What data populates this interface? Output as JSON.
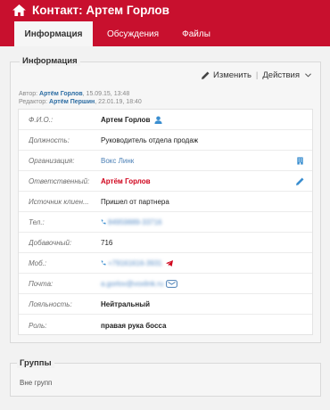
{
  "header": {
    "title": "Контакт:  Артем Горлов",
    "tabs": [
      {
        "label": "Информация",
        "active": true
      },
      {
        "label": "Обсуждения",
        "active": false
      },
      {
        "label": "Файлы",
        "active": false
      }
    ],
    "icon": "home-icon",
    "accent": "#c8102e"
  },
  "info": {
    "legend": "Информация",
    "edit_label": "Изменить",
    "separator": "|",
    "actions_label": "Действия",
    "author_prefix": "Автор: ",
    "author_name": "Артём Горлов",
    "author_date": ", 15.09.15, 13:48",
    "editor_prefix": "Редактор: ",
    "editor_name": "Артём Першин",
    "editor_date": ", 22.01.19, 18:40",
    "rows": [
      {
        "label": "Ф.И.О.:",
        "value": "Артем Горлов"
      },
      {
        "label": "Должность:",
        "value": "Руководитель отдела продаж"
      },
      {
        "label": "Организация:",
        "value": "Вокс Линк"
      },
      {
        "label": "Ответственный:",
        "value": "Артём Горлов"
      },
      {
        "label": "Источник клиен...",
        "value": "Пришел от партнера"
      },
      {
        "label": "Тел.:",
        "value": "84959889-33716"
      },
      {
        "label": "Добавочный:",
        "value": "716"
      },
      {
        "label": "Моб.:",
        "value": "+79161616-3931"
      },
      {
        "label": "Почта:",
        "value": "a.gorlov@voxlink.ru"
      },
      {
        "label": "Лояльность:",
        "value": "Нейтральный"
      },
      {
        "label": "Роль:",
        "value": "правая рука босса"
      }
    ]
  },
  "groups": {
    "legend": "Группы",
    "text": "Вне групп"
  },
  "colors": {
    "link": "#4a7fb5",
    "responsible": "#d0021b"
  }
}
